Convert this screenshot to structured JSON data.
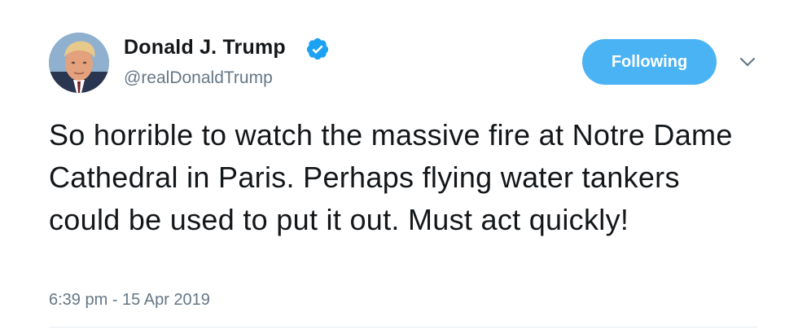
{
  "author": {
    "display_name": "Donald J. Trump",
    "handle": "@realDonaldTrump",
    "verified": true,
    "verified_color": "#1da1f2"
  },
  "actions": {
    "follow_label": "Following",
    "follow_color": "#4ab3f4",
    "menu_icon": "chevron-down-icon"
  },
  "tweet": {
    "text": "So horrible to watch the massive fire at Notre Dame Cathedral in Paris. Perhaps flying water tankers could be used to put it out. Must act quickly!",
    "timestamp": "6:39 pm - 15 Apr 2019"
  }
}
